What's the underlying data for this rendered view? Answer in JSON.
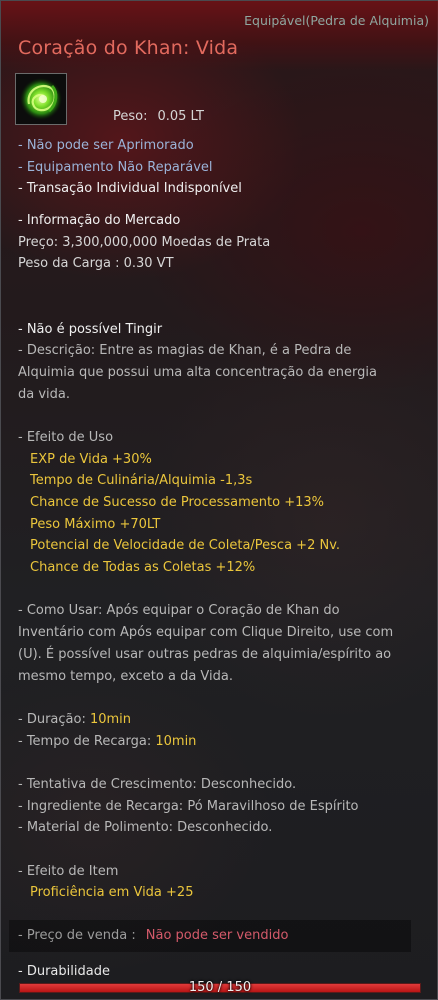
{
  "header": {
    "equip_type": "Equipável(Pedra de Alquimia)",
    "item_name": "Coração do Khan: Vida",
    "item_icon": "green-alchemy-stone-icon"
  },
  "weight": {
    "label": "Peso:",
    "value": "0.05 LT"
  },
  "flags": {
    "not_enhanceable": "- Não pode ser Aprimorado",
    "not_repairable": "- Equipamento Não Reparável",
    "personal_trade": "- Transação Individual Indisponível"
  },
  "market": {
    "title": "- Informação do Mercado",
    "price": "Preço: 3,300,000,000 Moedas de Prata",
    "cargo_weight": "Peso da Carga : 0.30 VT"
  },
  "dye": "- Não é possível Tingir",
  "description": [
    "- Descrição: Entre as magias de Khan, é a Pedra de",
    "Alquimia que possui uma alta concentração da energia",
    "da vida."
  ],
  "use_effect": {
    "title": "- Efeito de Uso",
    "effects": [
      "EXP de Vida +30%",
      "Tempo de Culinária/Alquimia -1,3s",
      "Chance de Sucesso de Processamento +13%",
      "Peso Máximo +70LT",
      "Potencial de Velocidade de Coleta/Pesca +2 Nv.",
      "Chance de Todas as Coletas +12%"
    ]
  },
  "how_to_use": [
    "- Como Usar: Após equipar o Coração de Khan do",
    "Inventário com Após equipar com Clique Direito, use com",
    "(U). É possível usar outras pedras de alquimia/espírito ao",
    "mesmo tempo, exceto a da Vida."
  ],
  "duration": {
    "label": "- Duração: ",
    "value": "10min"
  },
  "cooldown": {
    "label": "- Tempo de Recarga: ",
    "value": "10min"
  },
  "growth": "- Tentativa de Crescimento: Desconhecido.",
  "recharge_ingredient": "- Ingrediente de Recarga: Pó Maravilhoso de Espírito",
  "polish_material": "- Material de Polimento: Desconhecido.",
  "item_effect": {
    "title": "- Efeito de Item",
    "effects": [
      "Proficiência em Vida +25"
    ]
  },
  "sale": {
    "label": "- Preço de venda :",
    "value": "Não pode ser vendido"
  },
  "durability": {
    "label": "- Durabilidade",
    "text": "150 / 150",
    "fraction": 1.0
  }
}
